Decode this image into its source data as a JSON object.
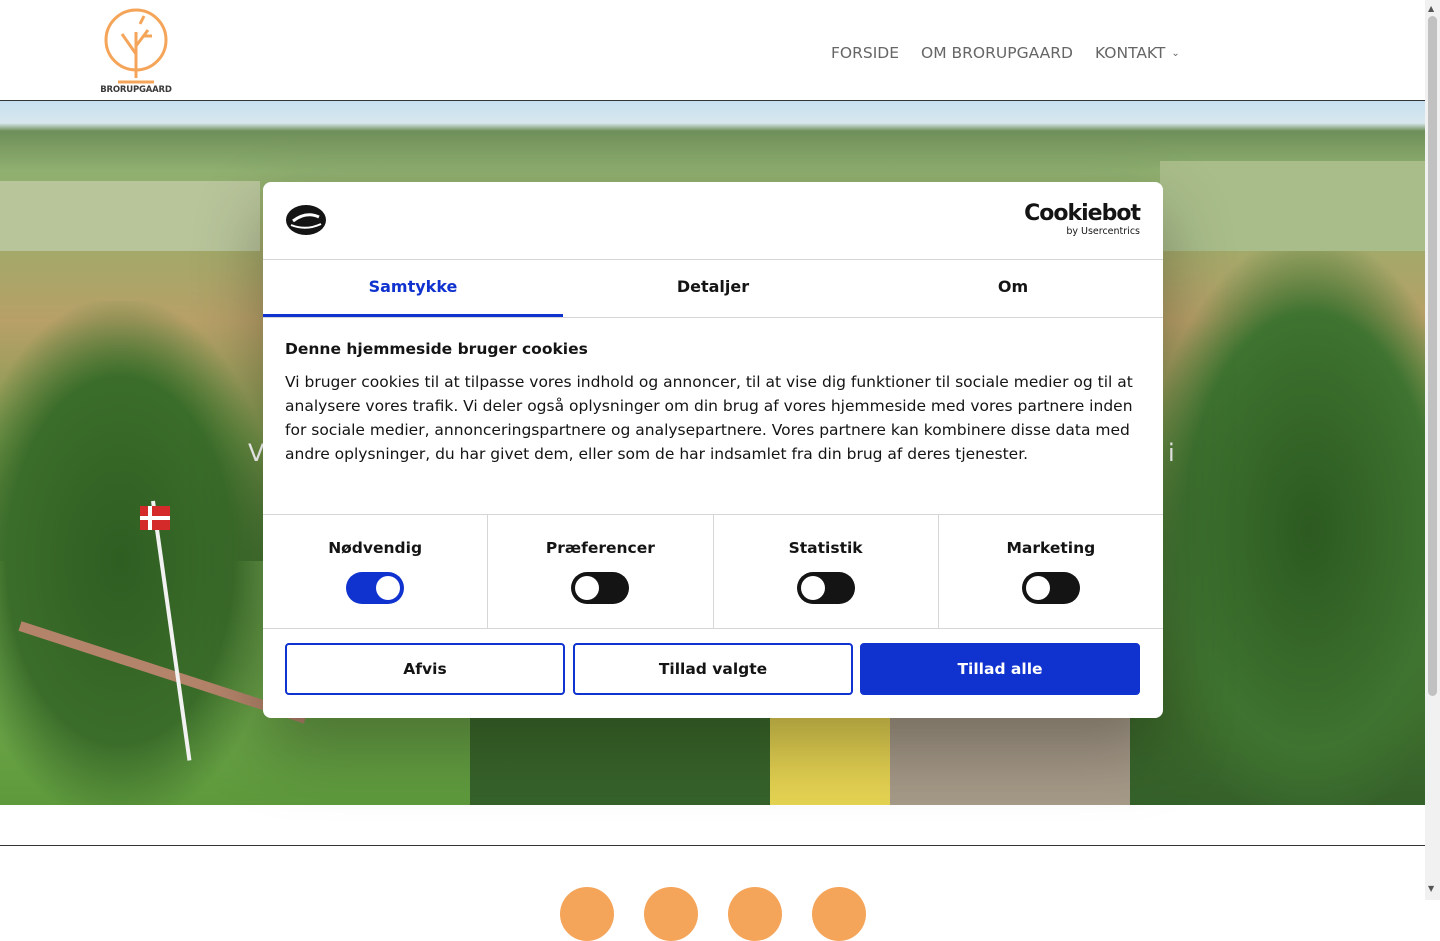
{
  "site": {
    "logo_text": "BRORUPGAARD",
    "nav": [
      {
        "label": "FORSIDE"
      },
      {
        "label": "OM BRORUPGAARD"
      },
      {
        "label": "KONTAKT"
      }
    ],
    "accent_color": "#f5a55a"
  },
  "hero": {
    "left_fragment": "V",
    "right_fragment": "i"
  },
  "cookie_dialog": {
    "brand_name": "Cookiebot",
    "brand_sub": "by Usercentrics",
    "tabs": [
      {
        "label": "Samtykke",
        "active": true
      },
      {
        "label": "Detaljer",
        "active": false
      },
      {
        "label": "Om",
        "active": false
      }
    ],
    "title": "Denne hjemmeside bruger cookies",
    "body": "Vi bruger cookies til at tilpasse vores indhold og annoncer, til at vise dig funktioner til sociale medier og til at analysere vores trafik. Vi deler også oplysninger om din brug af vores hjemmeside med vores partnere inden for sociale medier, annonceringspartnere og analysepartnere. Vores partnere kan kombinere disse data med andre oplysninger, du har givet dem, eller som de har indsamlet fra din brug af deres tjenester.",
    "toggles": [
      {
        "label": "Nødvendig",
        "on": true
      },
      {
        "label": "Præferencer",
        "on": false
      },
      {
        "label": "Statistik",
        "on": false
      },
      {
        "label": "Marketing",
        "on": false
      }
    ],
    "buttons": {
      "deny": "Afvis",
      "allow_selected": "Tillad valgte",
      "allow_all": "Tillad alle"
    },
    "primary_color": "#1032cf"
  }
}
